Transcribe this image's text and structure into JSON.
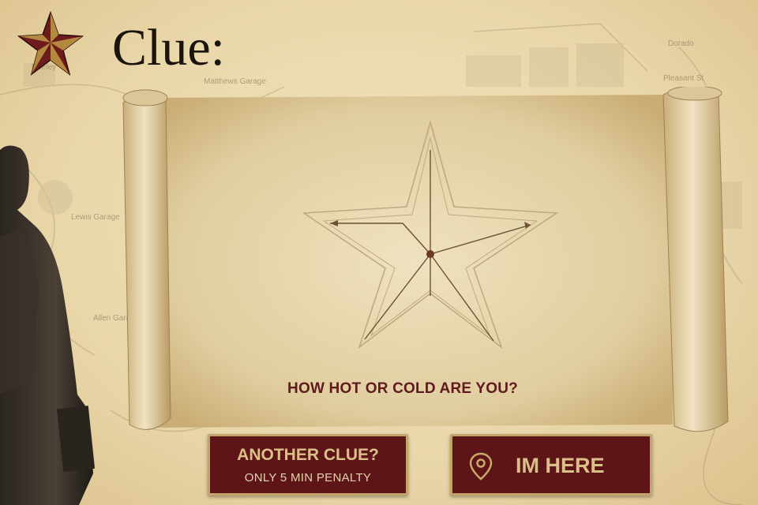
{
  "header": {
    "title": "Clue:"
  },
  "map": {
    "street_labels": [
      "Matthews Garage",
      "Lewis Garage",
      "Allen Garage",
      "Neeley",
      "Dorado",
      "Pleasant St"
    ]
  },
  "scroll": {
    "clue_text": "HOW HOT OR COLD ARE YOU?"
  },
  "buttons": {
    "another_clue_label": "ANOTHER CLUE?",
    "another_clue_sub": "ONLY 5 MIN PENALTY",
    "im_here_label": "IM HERE"
  },
  "icons": {
    "title_star": "texas-star-icon",
    "pin": "location-pin-icon"
  },
  "colors": {
    "button_bg": "#5d1518",
    "button_border": "#c3a46c",
    "button_text": "#dcc08a",
    "clue_text": "#5e1a1c"
  }
}
